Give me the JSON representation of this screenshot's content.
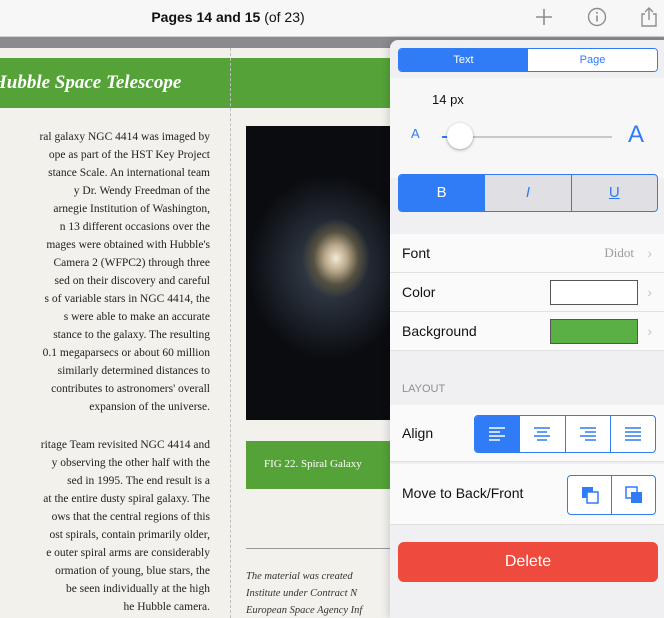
{
  "toolbar": {
    "title_bold": "Pages 14 and 15",
    "title_suffix": "(of 23)",
    "icons": [
      "plus-icon",
      "info-icon",
      "share-icon"
    ]
  },
  "document": {
    "header": "Hubble Space Telescope",
    "para1": "ral galaxy NGC 4414 was imaged by\nope as part of the HST Key Project\nstance Scale. An international team\ny Dr. Wendy Freedman of the\narnegie Institution of Washington,\nn 13 different occasions over the\nmages were obtained with Hubble's\nCamera 2 (WFPC2) through three\nsed on their discovery and careful\ns of variable stars in NGC 4414, the\ns were able to make an accurate\nstance to the galaxy. The resulting\n0.1 megaparsecs or about 60 million\nsimilarly determined distances to\ncontributes to astronomers' overall\nexpansion of the universe.",
    "para2": "ritage Team revisited NGC 4414 and\ny observing the other half with the\nsed in 1995. The end result is a\nat the entire dusty spiral galaxy. The\nows that the central regions of this\nost spirals, contain primarily older,\ne outer spiral arms are considerably\normation of young, blue stars, the\nbe seen individually at the high\nhe Hubble camera.",
    "caption": "FIG 22. Spiral Galaxy",
    "footnote": "The material was created\nInstitute under Contract N\nEuropean Space Agency Inf"
  },
  "inspector": {
    "tab_text": "Text",
    "tab_page": "Page",
    "font_size": "14 px",
    "slider_min_label": "A",
    "slider_max_label": "A",
    "font_size_fraction": 0.05,
    "bold_label": "B",
    "italic_label": "I",
    "underline_label": "U",
    "font_label": "Font",
    "font_value": "Didot",
    "color_label": "Color",
    "color_value": "#ffffff",
    "background_label": "Background",
    "background_value": "#5ab045",
    "layout_section": "LAYOUT",
    "align_label": "Align",
    "move_label": "Move to Back/Front",
    "delete_label": "Delete"
  },
  "colors": {
    "accent": "#2f7cf6",
    "header_green": "#55a338",
    "delete_red": "#ee4b3e"
  }
}
